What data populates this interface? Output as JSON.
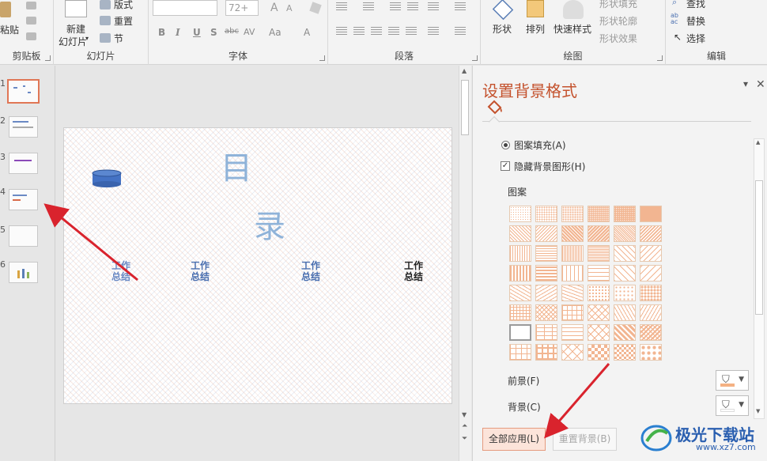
{
  "ribbon": {
    "clipboard": {
      "paste": "粘贴",
      "label": "剪贴板"
    },
    "slides": {
      "new_slide_line1": "新建",
      "new_slide_line2": "幻灯片",
      "layout": "版式",
      "reset": "重置",
      "section": "节",
      "label": "幻灯片"
    },
    "font": {
      "size": "72+",
      "label": "字体",
      "bold": "B",
      "italic": "I",
      "underline": "U",
      "shadow": "S",
      "strike": "abc",
      "spacing": "AV",
      "case": "Aa",
      "color": "A",
      "grow": "A",
      "shrink": "A"
    },
    "paragraph": {
      "label": "段落"
    },
    "drawing": {
      "shapes": "形状",
      "arrange": "排列",
      "quick_styles": "快速样式",
      "shape_fill": "形状填充",
      "shape_outline": "形状轮廓",
      "shape_effects": "形状效果",
      "label": "绘图"
    },
    "editing": {
      "find": "查找",
      "replace": "替换",
      "select": "选择",
      "label": "编辑",
      "replace_icon_text": "ab ac"
    }
  },
  "thumbnails": {
    "numbers": [
      "1",
      "2",
      "3",
      "4",
      "5",
      "6"
    ],
    "selected": 1
  },
  "slide": {
    "title_char1": "目",
    "title_char2": "录",
    "items": [
      "工作\n总结",
      "工作\n总结",
      "工作\n总结",
      "工作\n总结"
    ]
  },
  "pane": {
    "title": "设置背景格式",
    "pattern_fill": "图案填充(A)",
    "hide_bg": "隐藏背景图形(H)",
    "pattern_label": "图案",
    "foreground": "前景(F)",
    "background": "背景(C)",
    "apply_all": "全部应用(L)",
    "reset_bg": "重置背景(B)",
    "pin": "▾",
    "close": "✕"
  },
  "colors": {
    "accent": "#c4522d",
    "foreground_swatch": "#f4b183",
    "background_swatch": "#ffffff",
    "annotation_arrow": "#d9232d"
  },
  "watermark": {
    "brand": "极光下载站",
    "url": "www.xz7.com"
  }
}
